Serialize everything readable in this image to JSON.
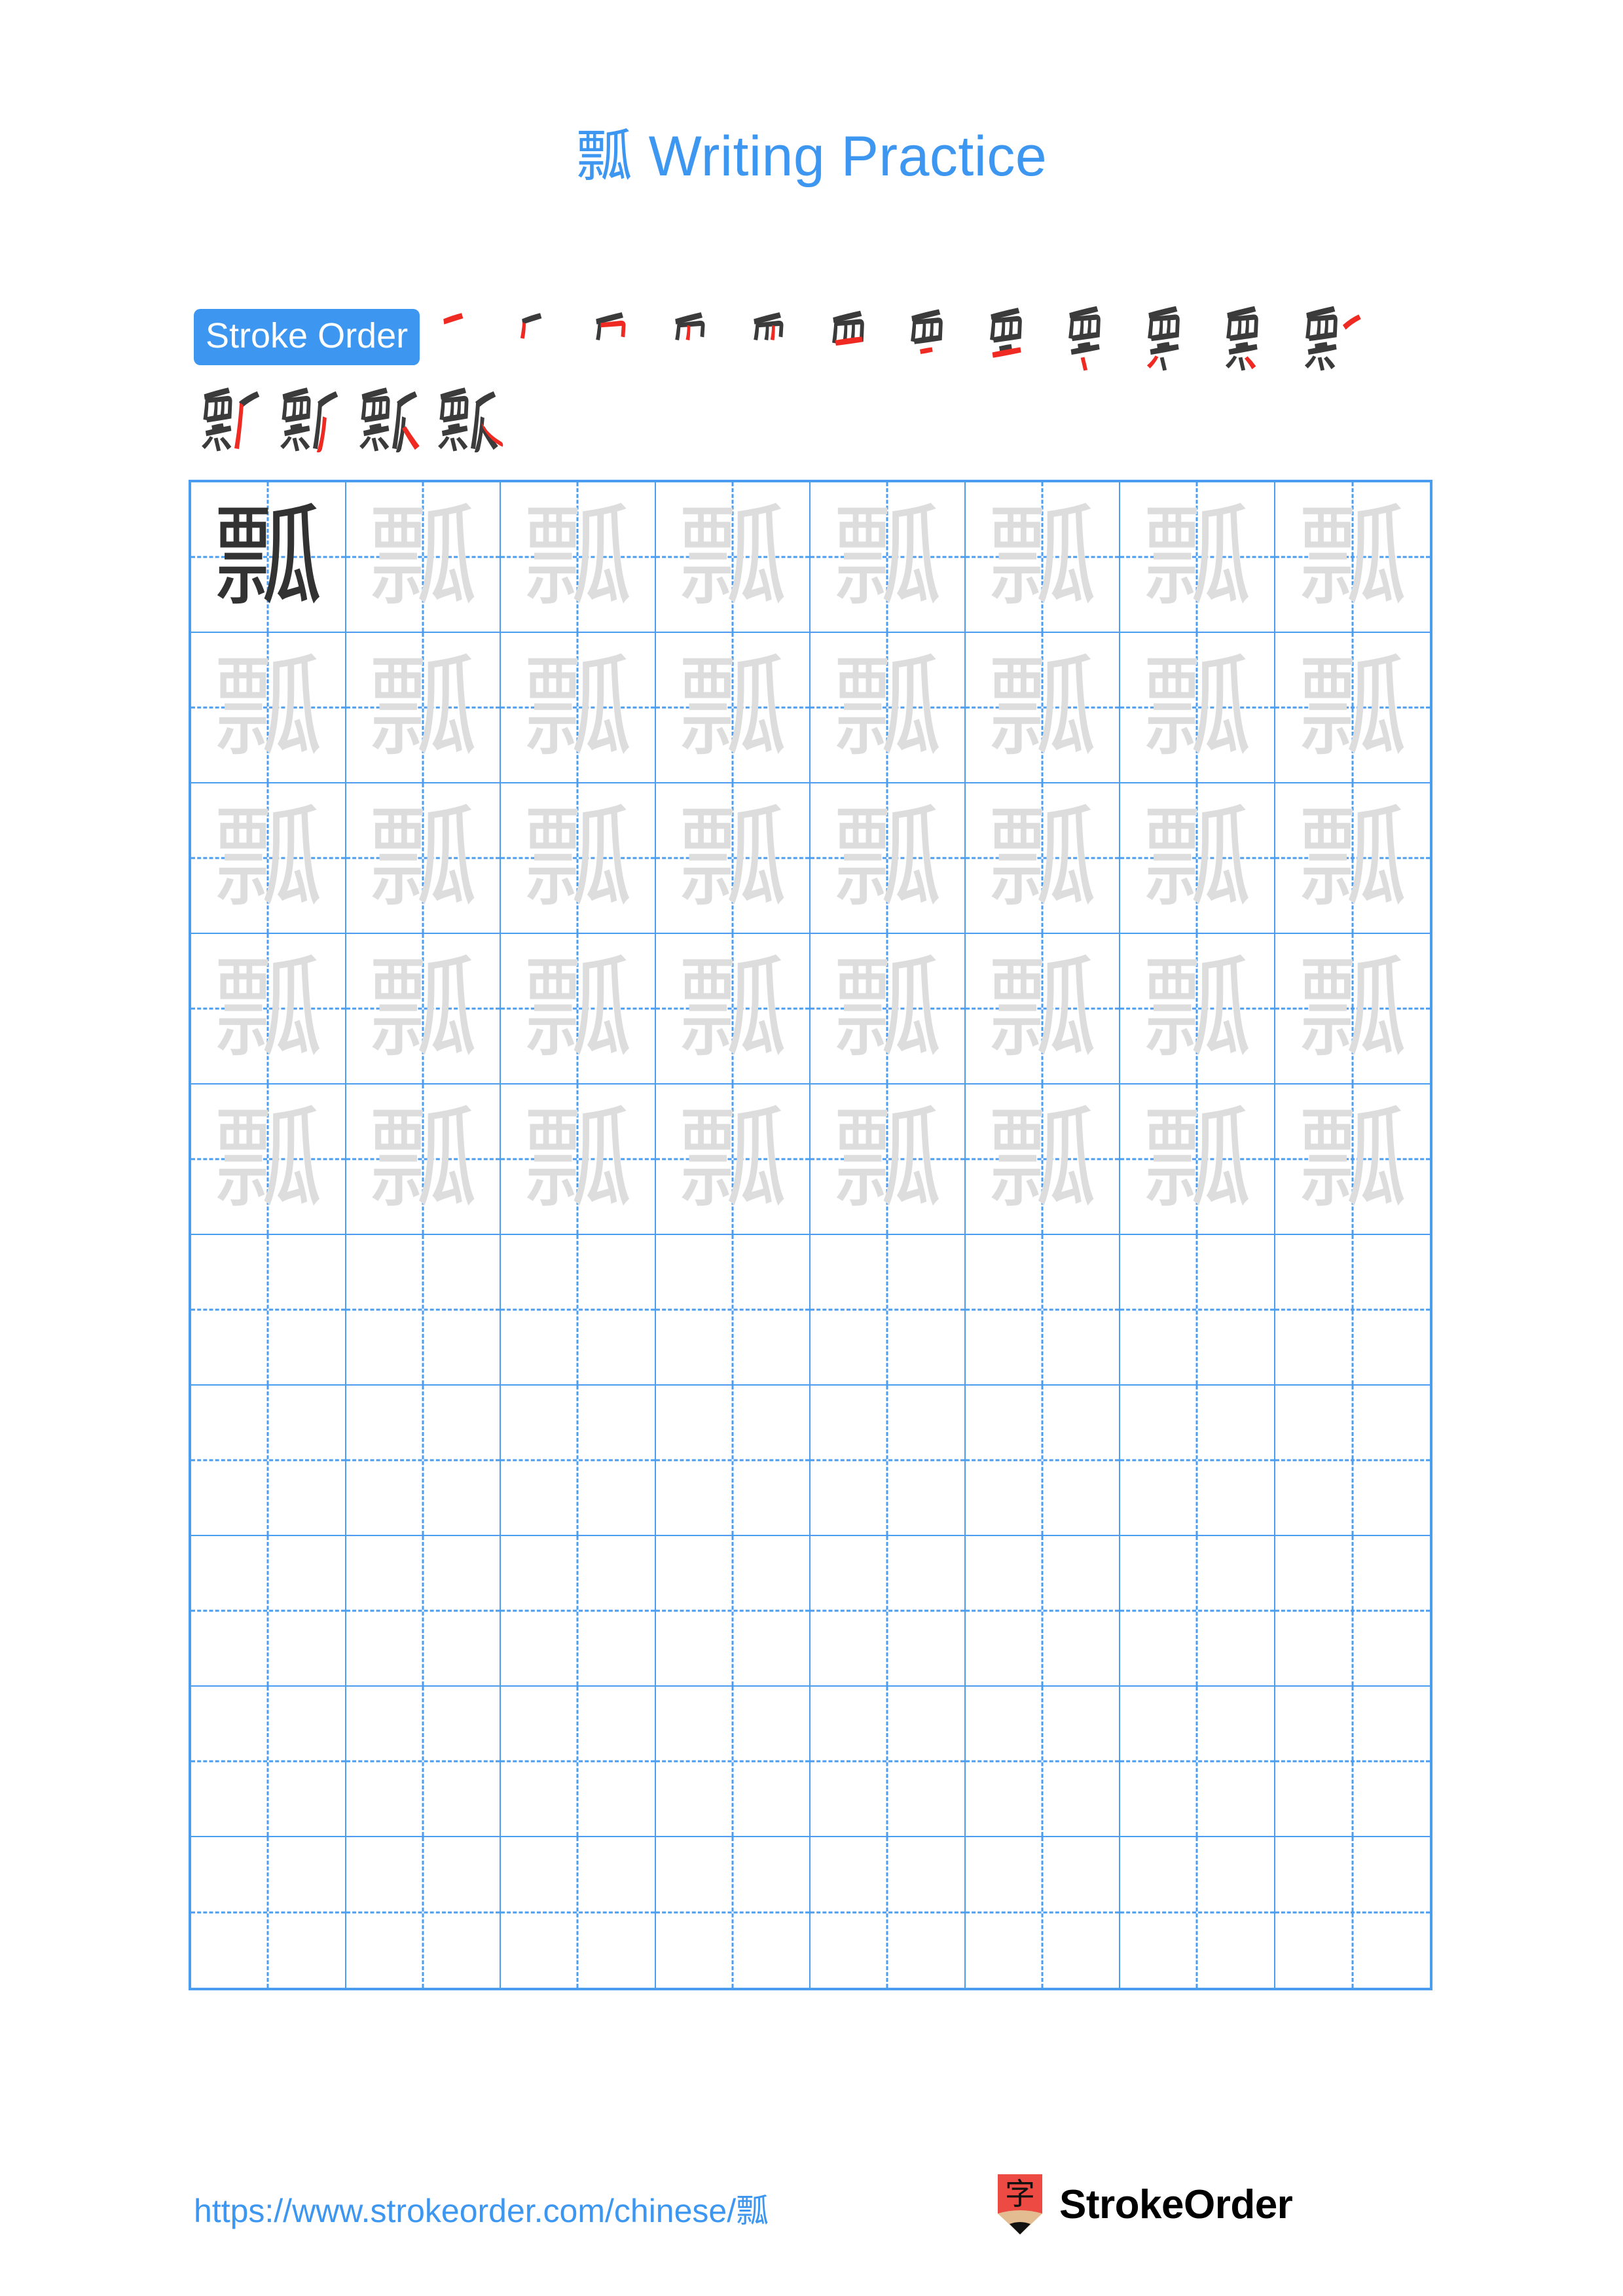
{
  "character": "瓢",
  "title": {
    "char": "瓢",
    "text": " Writing Practice",
    "full": "瓢 Writing Practice",
    "color": "#3d97f0"
  },
  "stroke_order": {
    "badge_label": "Stroke Order",
    "badge_bg": "#3d97f0",
    "badge_text_color": "#ffffff",
    "total_strokes": 16,
    "done_color": "#3b3b3b",
    "new_color": "#ee2a22",
    "row1_steps": [
      {
        "step": 1,
        "partial": "一"
      },
      {
        "step": 2,
        "partial": "丆"
      },
      {
        "step": 3,
        "partial": "帀"
      },
      {
        "step": 4,
        "partial": "帀"
      },
      {
        "step": 5,
        "partial": "而"
      },
      {
        "step": 6,
        "partial": "西"
      },
      {
        "step": 7,
        "partial": "西"
      },
      {
        "step": 8,
        "partial": "覀"
      },
      {
        "step": 9,
        "partial": "覀"
      },
      {
        "step": 10,
        "partial": "覀"
      },
      {
        "step": 11,
        "partial": "票"
      },
      {
        "step": 12,
        "partial": "票"
      }
    ],
    "row2_steps": [
      {
        "step": 13,
        "partial": "瓢"
      },
      {
        "step": 14,
        "partial": "瓢"
      },
      {
        "step": 15,
        "partial": "瓢"
      },
      {
        "step": 16,
        "partial": "瓢"
      }
    ]
  },
  "grid": {
    "columns": 8,
    "rows": 10,
    "line_color": "#4a9def",
    "dark_char_color": "#323232",
    "faint_char_color": "#dddddd",
    "filled_rows": 5,
    "empty_rows": 5,
    "dark_cells": [
      {
        "row": 0,
        "col": 0
      }
    ],
    "cells": [
      [
        "瓢",
        "瓢",
        "瓢",
        "瓢",
        "瓢",
        "瓢",
        "瓢",
        "瓢"
      ],
      [
        "瓢",
        "瓢",
        "瓢",
        "瓢",
        "瓢",
        "瓢",
        "瓢",
        "瓢"
      ],
      [
        "瓢",
        "瓢",
        "瓢",
        "瓢",
        "瓢",
        "瓢",
        "瓢",
        "瓢"
      ],
      [
        "瓢",
        "瓢",
        "瓢",
        "瓢",
        "瓢",
        "瓢",
        "瓢",
        "瓢"
      ],
      [
        "瓢",
        "瓢",
        "瓢",
        "瓢",
        "瓢",
        "瓢",
        "瓢",
        "瓢"
      ],
      [
        "",
        "",
        "",
        "",
        "",
        "",
        "",
        ""
      ],
      [
        "",
        "",
        "",
        "",
        "",
        "",
        "",
        ""
      ],
      [
        "",
        "",
        "",
        "",
        "",
        "",
        "",
        ""
      ],
      [
        "",
        "",
        "",
        "",
        "",
        "",
        "",
        ""
      ],
      [
        "",
        "",
        "",
        "",
        "",
        "",
        "",
        ""
      ]
    ]
  },
  "footer": {
    "url": "https://www.strokeorder.com/chinese/瓢",
    "url_color": "#3d97f0",
    "brand_name": "StrokeOrder",
    "logo_char": "字",
    "logo_body_color": "#ee4a44",
    "logo_tip_color": "#e3bd91",
    "logo_point_color": "#111111"
  }
}
